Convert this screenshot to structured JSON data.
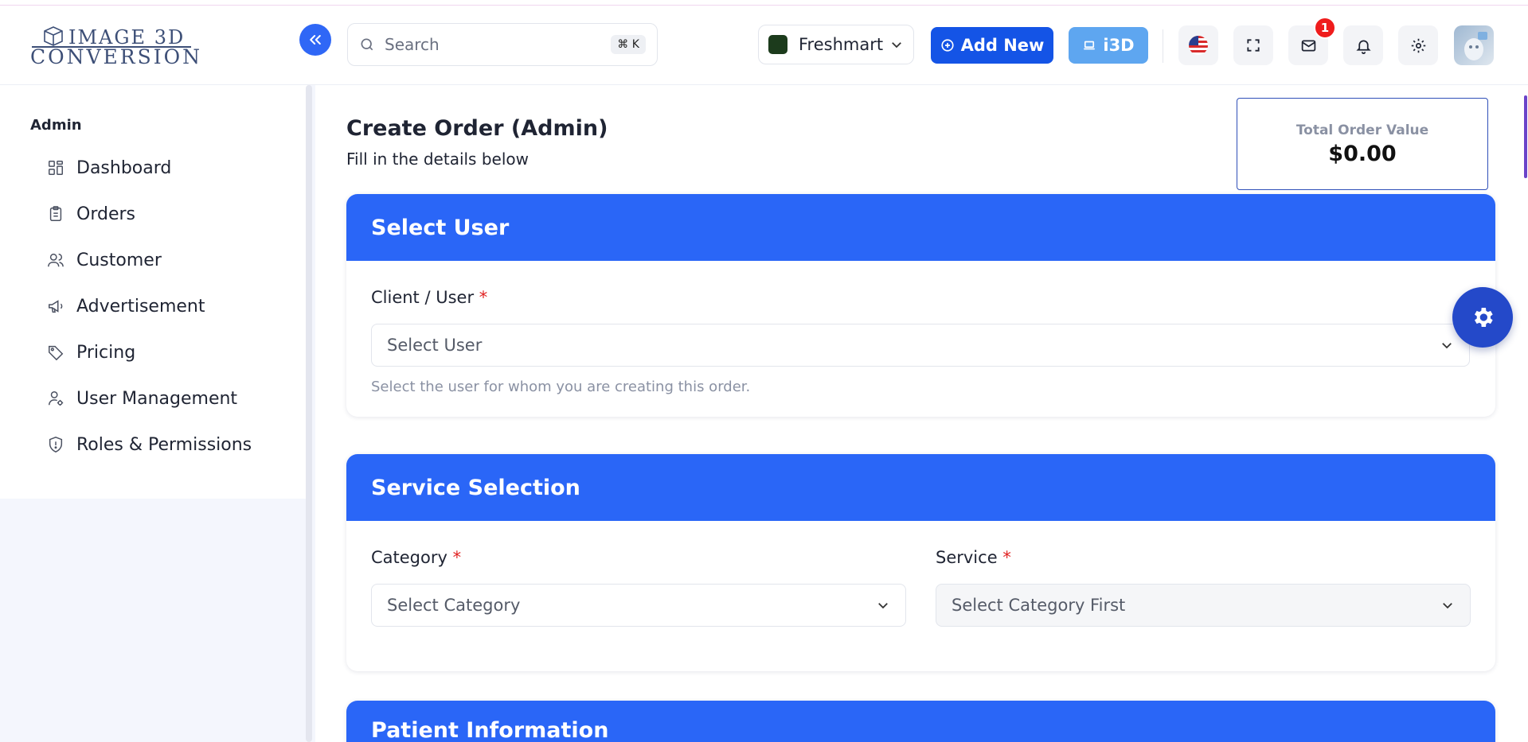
{
  "logo": {
    "line1": "IMAGE 3D",
    "line2": "CONVERSION"
  },
  "sidebar": {
    "section": "Admin",
    "items": [
      {
        "label": "Dashboard",
        "icon": "dashboard-icon"
      },
      {
        "label": "Orders",
        "icon": "clipboard-icon"
      },
      {
        "label": "Customer",
        "icon": "users-icon"
      },
      {
        "label": "Advertisement",
        "icon": "megaphone-icon"
      },
      {
        "label": "Pricing",
        "icon": "tag-icon"
      },
      {
        "label": "User Management",
        "icon": "user-gear-icon"
      },
      {
        "label": "Roles & Permissions",
        "icon": "shield-icon"
      }
    ]
  },
  "header": {
    "search_placeholder": "Search",
    "search_shortcut": "⌘ K",
    "store_name": "Freshmart",
    "add_new_label": "Add New",
    "i3d_label": "i3D",
    "mail_badge": "1"
  },
  "page": {
    "title": "Create Order (Admin)",
    "subtitle": "Fill in the details below"
  },
  "total": {
    "label": "Total Order Value",
    "value": "$0.00"
  },
  "select_user": {
    "heading": "Select User",
    "label": "Client / User",
    "placeholder": "Select User",
    "help": "Select the user for whom you are creating this order."
  },
  "service_selection": {
    "heading": "Service Selection",
    "category_label": "Category",
    "category_placeholder": "Select Category",
    "service_label": "Service",
    "service_placeholder": "Select Category First"
  },
  "patient_info": {
    "heading": "Patient Information"
  },
  "required_mark": "*",
  "colors": {
    "primary": "#2a66f7",
    "add_new": "#1454e6",
    "i3d": "#5ea6f0",
    "badge": "#ef1c1c"
  }
}
